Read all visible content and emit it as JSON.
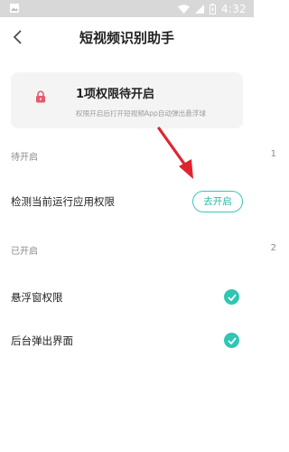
{
  "status_bar": {
    "time": "4:32"
  },
  "header": {
    "title": "短视频识别助手"
  },
  "info_card": {
    "title": "1项权限待开启",
    "subtitle": "权限开启后打开短视频App自动弹出悬浮球"
  },
  "pending_section": {
    "label": "待开启",
    "count": "1",
    "items": [
      {
        "label": "检测当前运行应用权限",
        "action_label": "去开启"
      }
    ]
  },
  "enabled_section": {
    "label": "已开启",
    "count": "2",
    "items": [
      {
        "label": "悬浮窗权限"
      },
      {
        "label": "后台弹出界面"
      }
    ]
  },
  "colors": {
    "accent": "#2fc6b3",
    "arrow": "#e0242f",
    "lock": "#e85a6a"
  },
  "icons": [
    "image-icon",
    "wifi-icon",
    "signal-icon",
    "battery-icon",
    "back-chevron-icon",
    "lock-icon",
    "check-icon",
    "arrow-annotation"
  ]
}
